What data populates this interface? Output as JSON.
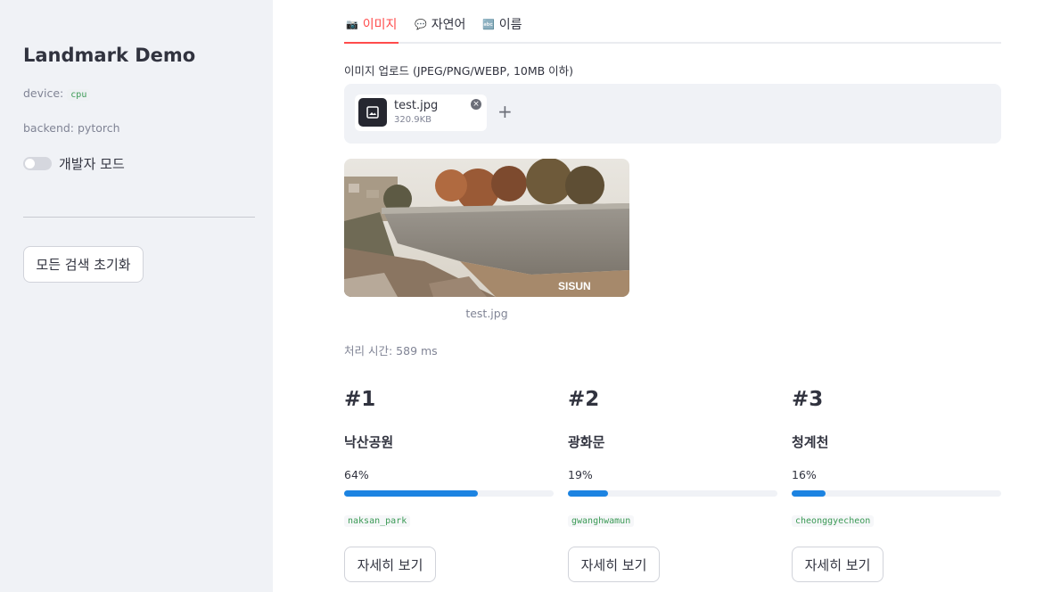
{
  "sidebar": {
    "title": "Landmark Demo",
    "device_label": "device:",
    "device_value": "cpu",
    "backend": "backend: pytorch",
    "dev_mode_label": "개발자 모드",
    "dev_mode_on": false,
    "reset_label": "모든 검색 초기화"
  },
  "tabs": [
    {
      "icon": "📷",
      "label": "이미지",
      "active": true
    },
    {
      "icon": "💬",
      "label": "자연어",
      "active": false
    },
    {
      "icon": "🔤",
      "label": "이름",
      "active": false
    }
  ],
  "upload": {
    "label": "이미지 업로드 (JPEG/PNG/WEBP, 10MB 이하)",
    "file_name": "test.jpg",
    "file_size": "320.9KB",
    "add_symbol": "+"
  },
  "image": {
    "caption": "test.jpg",
    "watermark": "SISUN"
  },
  "timing": "처리 시간: 589 ms",
  "results": [
    {
      "rank": "#1",
      "name": "낙산공원",
      "percent_text": "64%",
      "score": 0.64,
      "slug": "naksan_park",
      "button": "자세히 보기"
    },
    {
      "rank": "#2",
      "name": "광화문",
      "percent_text": "19%",
      "score": 0.19,
      "slug": "gwanghwamun",
      "button": "자세히 보기"
    },
    {
      "rank": "#3",
      "name": "청계천",
      "percent_text": "16%",
      "score": 0.16,
      "slug": "cheonggyecheon",
      "button": "자세히 보기"
    }
  ],
  "colors": {
    "accent": "#ff4b4b",
    "progress": "#1c83e1",
    "sidebar_bg": "#f0f2f6"
  }
}
